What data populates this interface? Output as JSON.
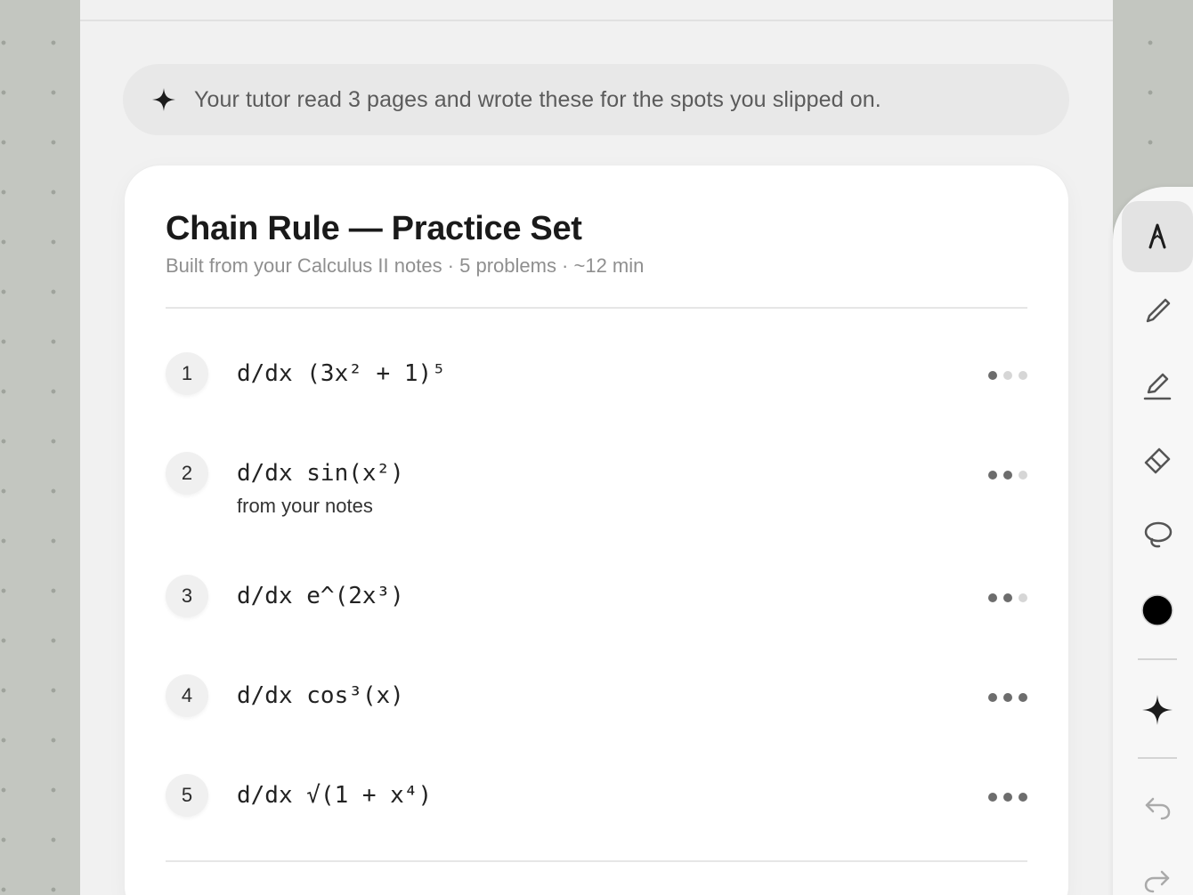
{
  "banner": {
    "icon": "sparkle-icon",
    "text": "Your tutor read 3 pages and wrote these for the spots you slipped on."
  },
  "practice_set": {
    "title": "Chain Rule — Practice Set",
    "subtitle": "Built from your Calculus II notes · 5 problems · ~12 min",
    "problems": [
      {
        "number": "1",
        "expression": "d/dx (3x² + 1)⁵",
        "note": "",
        "difficulty": 1
      },
      {
        "number": "2",
        "expression": "d/dx sin(x²)",
        "note": "from your notes",
        "difficulty": 2
      },
      {
        "number": "3",
        "expression": "d/dx e^(2x³)",
        "note": "",
        "difficulty": 2
      },
      {
        "number": "4",
        "expression": "d/dx cos³(x)",
        "note": "",
        "difficulty": 3
      },
      {
        "number": "5",
        "expression": "d/dx √(1 + x⁴)",
        "note": "",
        "difficulty": 3
      }
    ],
    "difficulty_max": 3
  },
  "toolbar": {
    "tools": [
      {
        "name": "pen-tool",
        "icon": "fountain-pen-icon",
        "active": true
      },
      {
        "name": "pencil-tool",
        "icon": "pencil-icon",
        "active": false
      },
      {
        "name": "highlighter-tool",
        "icon": "highlighter-icon",
        "active": false
      },
      {
        "name": "eraser-tool",
        "icon": "eraser-icon",
        "active": false
      },
      {
        "name": "lasso-tool",
        "icon": "lasso-icon",
        "active": false
      },
      {
        "name": "color-picker",
        "icon": "color-swatch-icon",
        "active": false
      },
      {
        "name": "ai-assist",
        "icon": "sparkle-icon",
        "active": false
      },
      {
        "name": "undo",
        "icon": "undo-icon",
        "active": false
      },
      {
        "name": "redo",
        "icon": "redo-icon",
        "active": false
      }
    ],
    "selected_color": "#000000"
  },
  "colors": {
    "canvas": "#c3c6c0",
    "page": "#f1f1f1",
    "card": "#ffffff",
    "dot_on": "#6d6d6d",
    "dot_off": "#d6d6d6"
  }
}
